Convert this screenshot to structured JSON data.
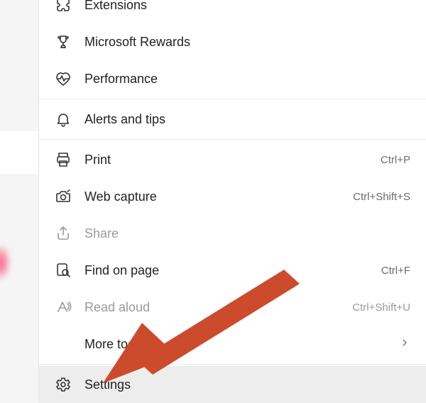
{
  "menu": {
    "items": [
      {
        "key": "extensions",
        "label": "Extensions",
        "shortcut": "",
        "iconName": "puzzle-icon",
        "disabled": false,
        "hasSubmenu": false
      },
      {
        "key": "microsoft-rewards",
        "label": "Microsoft Rewards",
        "shortcut": "",
        "iconName": "trophy-icon",
        "disabled": false,
        "hasSubmenu": false
      },
      {
        "key": "performance",
        "label": "Performance",
        "shortcut": "",
        "iconName": "heart-rate-icon",
        "disabled": false,
        "hasSubmenu": false
      },
      {
        "key": "alerts-tips",
        "label": "Alerts and tips",
        "shortcut": "",
        "iconName": "bell-icon",
        "disabled": false,
        "hasSubmenu": false
      },
      {
        "key": "print",
        "label": "Print",
        "shortcut": "Ctrl+P",
        "iconName": "printer-icon",
        "disabled": false,
        "hasSubmenu": false
      },
      {
        "key": "web-capture",
        "label": "Web capture",
        "shortcut": "Ctrl+Shift+S",
        "iconName": "camera-icon",
        "disabled": false,
        "hasSubmenu": false
      },
      {
        "key": "share",
        "label": "Share",
        "shortcut": "",
        "iconName": "share-icon",
        "disabled": true,
        "hasSubmenu": false
      },
      {
        "key": "find-on-page",
        "label": "Find on page",
        "shortcut": "Ctrl+F",
        "iconName": "find-icon",
        "disabled": false,
        "hasSubmenu": false
      },
      {
        "key": "read-aloud",
        "label": "Read aloud",
        "shortcut": "Ctrl+Shift+U",
        "iconName": "read-aloud-icon",
        "disabled": true,
        "hasSubmenu": false
      },
      {
        "key": "more-tools",
        "label": "More tools",
        "shortcut": "",
        "iconName": "",
        "disabled": false,
        "hasSubmenu": true
      },
      {
        "key": "settings",
        "label": "Settings",
        "shortcut": "",
        "iconName": "gear-icon",
        "disabled": false,
        "hasSubmenu": false
      }
    ]
  },
  "annotation": {
    "arrowColor": "#cc4b2c"
  }
}
